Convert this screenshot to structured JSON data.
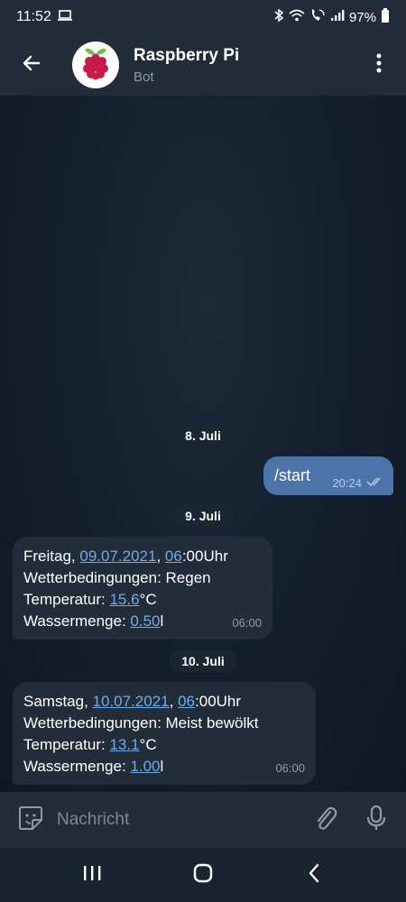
{
  "status_bar": {
    "time": "11:52",
    "battery": "97%"
  },
  "header": {
    "title": "Raspberry Pi",
    "subtitle": "Bot"
  },
  "messages": {
    "date1": "8. Juli",
    "outgoing": {
      "text": "/start",
      "time": "20:24"
    },
    "date2": "9. Juli",
    "msg1": {
      "day": "Freitag, ",
      "date": "09.07.2021",
      "sep": ", ",
      "hour": "06",
      "time_suffix": ":00Uhr",
      "weather": "Wetterbedingungen: Regen",
      "temp_label": "Temperatur: ",
      "temp_value": "15.6",
      "temp_unit": "°C",
      "water_label": "Wassermenge: ",
      "water_value": "0.50",
      "water_unit": "l",
      "time": "06:00"
    },
    "date3": "10. Juli",
    "msg2": {
      "day": "Samstag, ",
      "date": "10.07.2021",
      "sep": ", ",
      "hour": "06",
      "time_suffix": ":00Uhr",
      "weather": "Wetterbedingungen: Meist bewölkt",
      "temp_label": "Temperatur: ",
      "temp_value": "13.1",
      "temp_unit": "°C",
      "water_label": "Wassermenge: ",
      "water_value": "1.00",
      "water_unit": "l",
      "time": "06:00"
    }
  },
  "input": {
    "placeholder": "Nachricht"
  },
  "colors": {
    "header_bg": "#222d39",
    "outgoing_bubble": "#4d74a8",
    "incoming_bubble": "#222d39",
    "link": "#71aaeb"
  }
}
